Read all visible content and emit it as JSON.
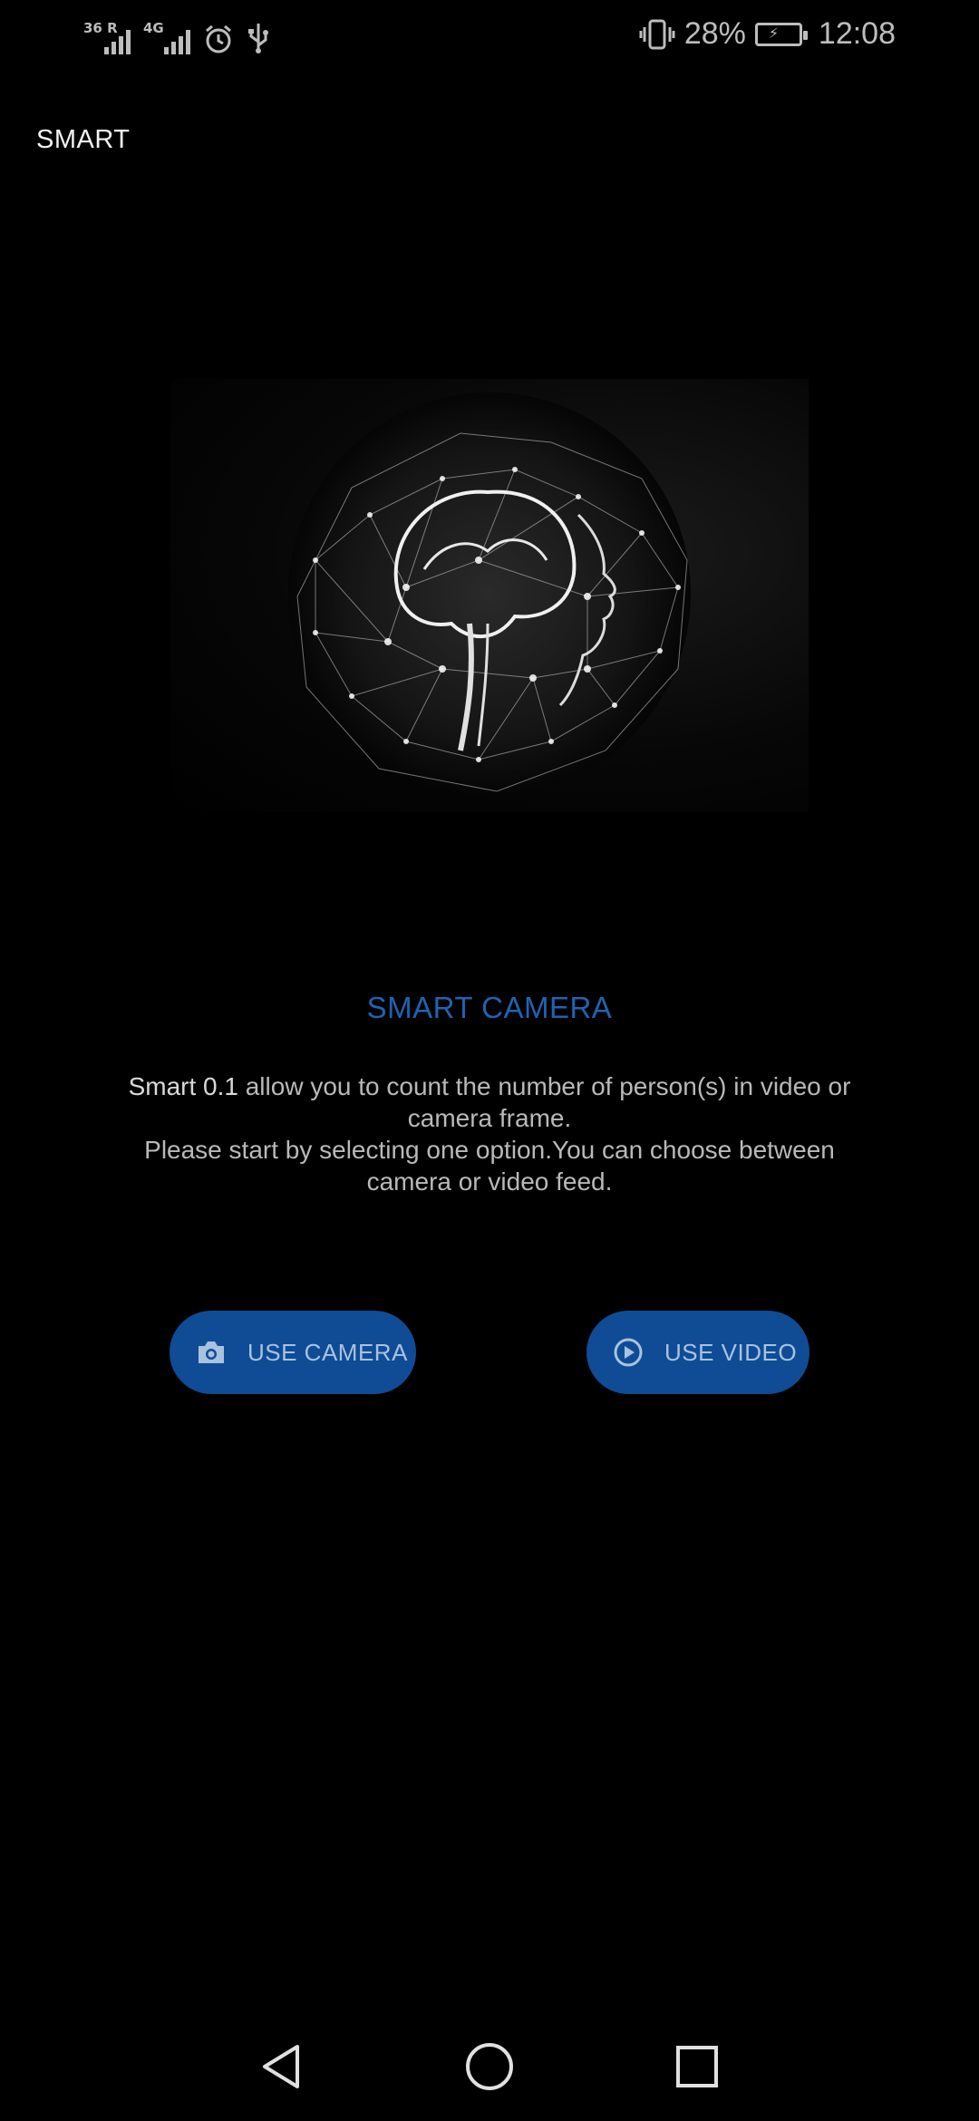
{
  "status_bar": {
    "network_1": "36 R",
    "network_2": "4G",
    "battery_percent": "28%",
    "time": "12:08",
    "icons": [
      "signal-icon",
      "signal-icon",
      "alarm-icon",
      "usb-icon",
      "vibrate-icon",
      "battery-charging-icon"
    ]
  },
  "app_bar": {
    "title": "SMART"
  },
  "hero": {
    "icon": "ai-head-network-image"
  },
  "main": {
    "heading": "SMART CAMERA",
    "app_name": "Smart 0.1",
    "description_rest": " allow you to count the number of person(s) in video or camera frame.",
    "description_line2": "Please start by selecting one option.You can choose between camera or video feed."
  },
  "buttons": {
    "camera_label": "USE CAMERA",
    "video_label": "USE VIDEO",
    "camera_icon": "camera-icon",
    "video_icon": "play-circle-icon"
  },
  "colors": {
    "background": "#000000",
    "accent": "#1f63b2",
    "button_bg": "#0f4c95",
    "button_text": "#a9c2df"
  },
  "nav_bar": {
    "icons": [
      "back-icon",
      "home-icon",
      "recents-icon"
    ]
  }
}
